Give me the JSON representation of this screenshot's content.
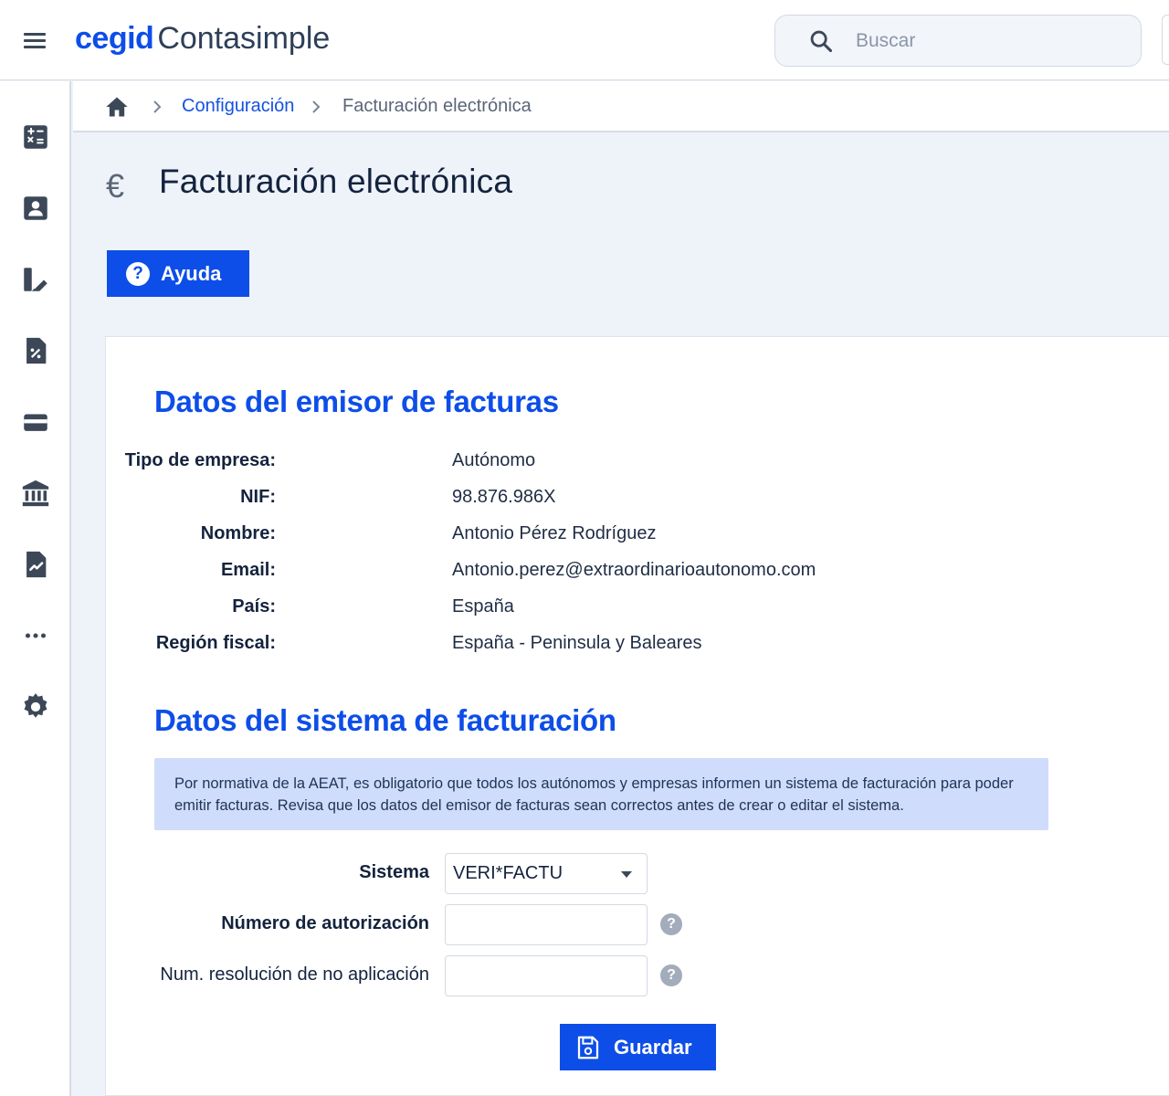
{
  "app": {
    "brand": "cegid",
    "product": "Contasimple"
  },
  "search": {
    "placeholder": "Buscar"
  },
  "sidebar": {
    "items": [
      {
        "icon": "calculator-icon"
      },
      {
        "icon": "contact-card-icon"
      },
      {
        "icon": "purchases-icon"
      },
      {
        "icon": "tax-document-icon"
      },
      {
        "icon": "wallet-icon"
      },
      {
        "icon": "bank-icon"
      },
      {
        "icon": "reports-icon"
      },
      {
        "icon": "more-icon"
      },
      {
        "icon": "gear-icon"
      }
    ]
  },
  "breadcrumb": {
    "link": "Configuración",
    "current": "Facturación electrónica"
  },
  "page": {
    "title": "Facturación electrónica",
    "icon_glyph": "€",
    "help_label": "Ayuda",
    "help_glyph": "?"
  },
  "issuer": {
    "title": "Datos del emisor de facturas",
    "rows": [
      {
        "label": "Tipo de empresa:",
        "value": "Autónomo"
      },
      {
        "label": "NIF:",
        "value": "98.876.986X"
      },
      {
        "label": "Nombre:",
        "value": "Antonio Pérez Rodríguez"
      },
      {
        "label": "Email:",
        "value": "Antonio.perez@extraordinarioautonomo.com"
      },
      {
        "label": "País:",
        "value": "España"
      },
      {
        "label": "Región fiscal:",
        "value": "España - Peninsula y Baleares"
      }
    ]
  },
  "system": {
    "title": "Datos del sistema de facturación",
    "notice": "Por normativa de la AEAT, es obligatorio que todos los autónomos y empresas informen un sistema de facturación para poder emitir facturas. Revisa que los datos del emisor de facturas sean correctos antes de crear o editar el sistema.",
    "sistema_label": "Sistema",
    "sistema_value": "VERI*FACTU",
    "auth_label": "Número de autorización",
    "auth_value": "",
    "resolution_label": "Num. resolución de no aplicación",
    "resolution_value": "",
    "help_glyph": "?",
    "save_label": "Guardar"
  },
  "colors": {
    "accent": "#0d4ee8",
    "notice_bg": "#cfdcfb",
    "page_bg": "#eef3fa"
  }
}
